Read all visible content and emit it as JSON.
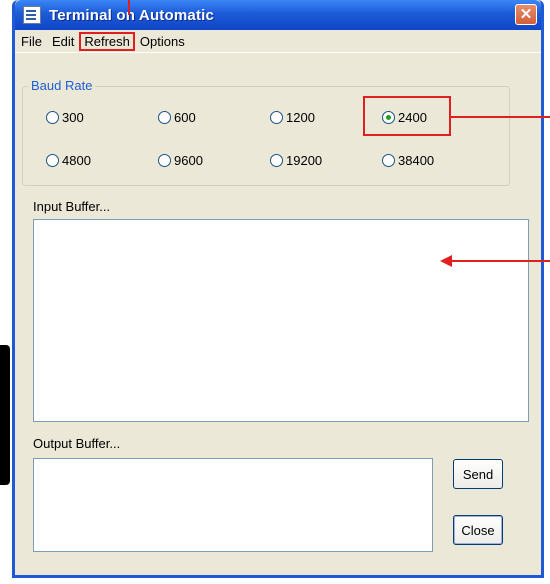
{
  "window": {
    "title": "Terminal on Automatic",
    "close_glyph": "✕"
  },
  "menu": {
    "items": [
      "File",
      "Edit",
      "Refresh",
      "Options"
    ]
  },
  "baud": {
    "legend": "Baud Rate",
    "options": [
      "300",
      "600",
      "1200",
      "2400",
      "4800",
      "9600",
      "19200",
      "38400"
    ],
    "selected": "2400"
  },
  "input": {
    "label": "Input Buffer..."
  },
  "output": {
    "label": "Output Buffer..."
  },
  "buttons": {
    "send": "Send",
    "close": "Close"
  },
  "colors": {
    "titlebar": "#1c5ad8",
    "annotation": "#e02020",
    "legend": "#1d5fd1"
  }
}
